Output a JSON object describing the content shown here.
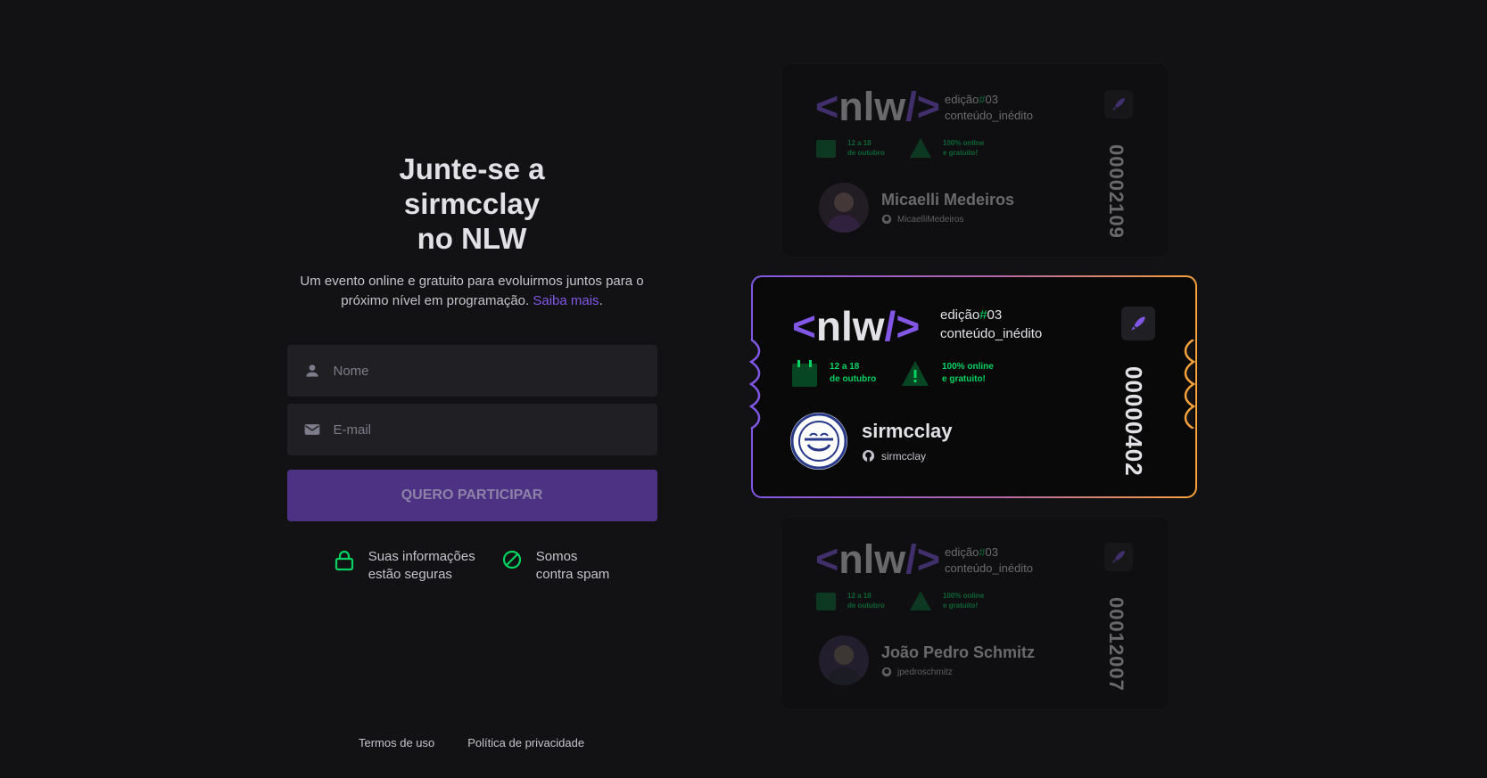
{
  "heading": {
    "line1": "Junte-se a",
    "line2": "sirmcclay",
    "line3": "no NLW"
  },
  "subtitle": {
    "text": "Um evento online e gratuito para evoluirmos juntos para o próximo nível em programação.",
    "link": "Saiba mais",
    "suffix": "."
  },
  "form": {
    "name_placeholder": "Nome",
    "email_placeholder": "E-mail",
    "submit_label": "QUERO PARTICIPAR"
  },
  "notes": {
    "secure_line1": "Suas informações",
    "secure_line2": "estão seguras",
    "spam_line1": "Somos",
    "spam_line2": "contra spam"
  },
  "footer": {
    "terms": "Termos de uso",
    "privacy": "Política de privacidade"
  },
  "ticket_common": {
    "logo_open": "<",
    "logo_text": "nlw",
    "logo_close": "/>",
    "edition_label": "edição",
    "edition_hash": "#",
    "edition_number": "03",
    "content_label": "conteúdo_inédito",
    "date_line1": "12 a 18",
    "date_line2": "de outubro",
    "online_line1": "100% online",
    "online_line2": "e gratuito!"
  },
  "tickets": [
    {
      "name": "Micaelli Medeiros",
      "github": "MicaelliMedeiros",
      "number": "00002109"
    },
    {
      "name": "sirmcclay",
      "github": "sirmcclay",
      "number": "00000402"
    },
    {
      "name": "João Pedro Schmitz",
      "github": "jpedroschmitz",
      "number": "00012007"
    }
  ],
  "colors": {
    "brand": "#8257e5",
    "green": "#04d361",
    "orange": "#f7a23a",
    "background": "#121214"
  }
}
